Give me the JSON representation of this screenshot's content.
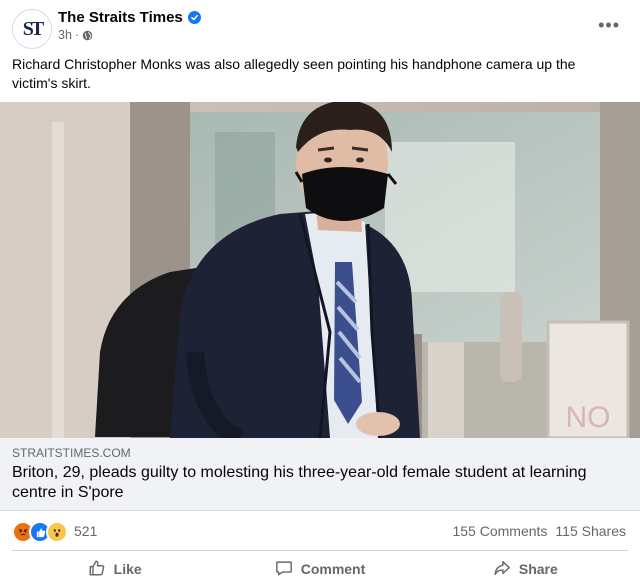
{
  "post": {
    "page_name": "The Straits Times",
    "avatar_text": "ST",
    "time": "3h",
    "separator": "·",
    "more_label": "•••",
    "caption": "Richard Christopher Monks was also allegedly seen pointing his handphone camera up the victim's skirt."
  },
  "link_preview": {
    "domain": "STRAITSTIMES.COM",
    "headline": "Briton, 29, pleads guilty to molesting his three-year-old female student at learning centre in S'pore"
  },
  "reactions": {
    "icons": [
      "angry-reaction-icon",
      "like-reaction-icon",
      "wow-reaction-icon"
    ],
    "count": "521",
    "comments": "155 Comments",
    "shares": "115 Shares"
  },
  "actions": {
    "like": "Like",
    "comment": "Comment",
    "share": "Share"
  },
  "colors": {
    "accent": "#1877f2",
    "secondary_text": "#65676b",
    "link_bg": "#f0f2f5"
  }
}
